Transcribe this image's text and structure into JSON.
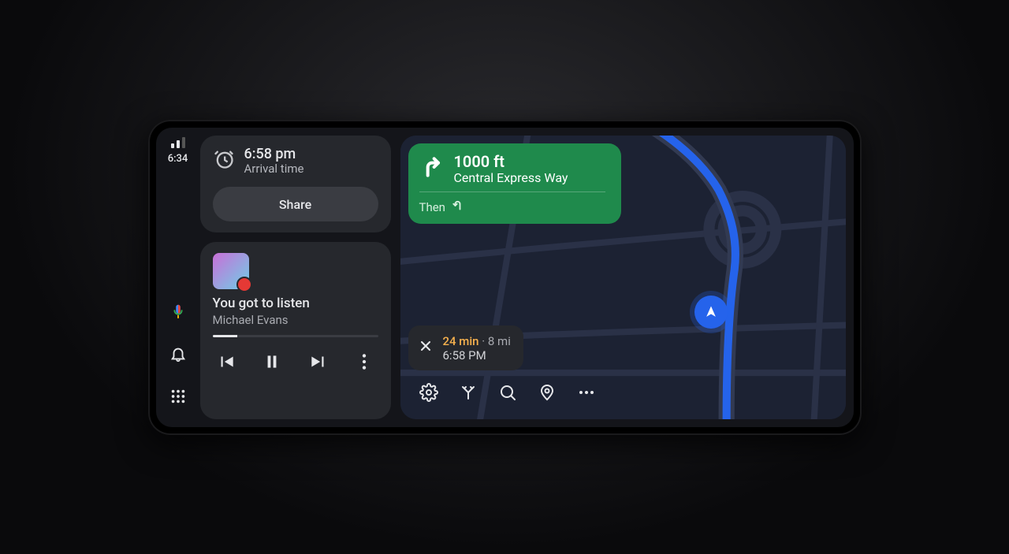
{
  "status": {
    "clock": "6:34"
  },
  "eta_card": {
    "time": "6:58 pm",
    "label": "Arrival time",
    "share": "Share"
  },
  "media": {
    "track": "You got to listen",
    "artist": "Michael Evans"
  },
  "nav": {
    "distance": "1000 ft",
    "road": "Central Express Way",
    "then_label": "Then"
  },
  "trip": {
    "duration": "24 min",
    "separator": " · ",
    "distance": "8 mi",
    "arrival": "6:58 PM"
  }
}
